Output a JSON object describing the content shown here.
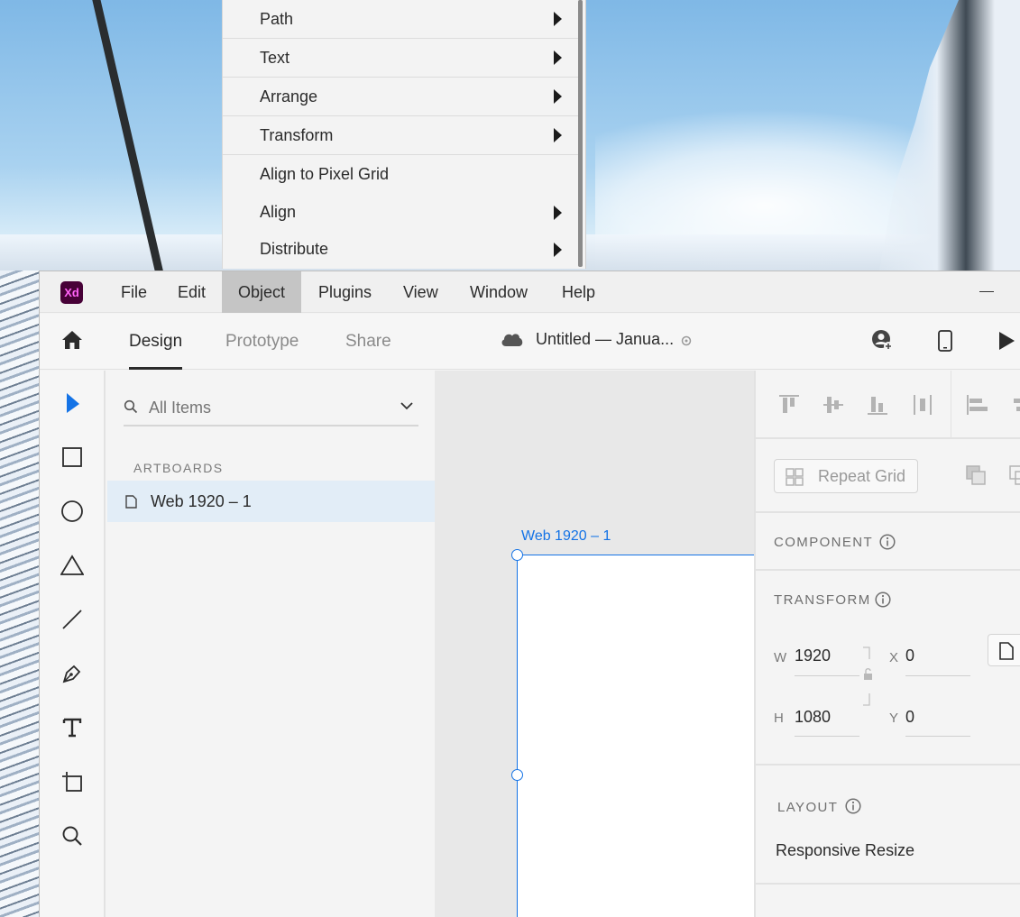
{
  "context_menu": {
    "items": [
      {
        "label": "Path",
        "submenu": true
      },
      {
        "label": "Text",
        "submenu": true
      },
      {
        "label": "Arrange",
        "submenu": true
      },
      {
        "label": "Transform",
        "submenu": true
      },
      {
        "label": "Align to Pixel Grid",
        "submenu": false
      },
      {
        "label": "Align",
        "submenu": true
      },
      {
        "label": "Distribute",
        "submenu": true
      }
    ]
  },
  "app": {
    "logo_text": "Xd",
    "menubar": [
      "File",
      "Edit",
      "Object",
      "Plugins",
      "View",
      "Window",
      "Help"
    ],
    "active_menu": "Object",
    "tabs": [
      "Design",
      "Prototype",
      "Share"
    ],
    "active_tab": "Design",
    "document_title": "Untitled — Janua...",
    "toolbar_icons": [
      "home-icon",
      "cloud-icon",
      "sync-icon",
      "invite-user-icon",
      "mobile-preview-icon",
      "play-icon"
    ],
    "tools": [
      "select-tool-icon",
      "rectangle-tool-icon",
      "ellipse-tool-icon",
      "polygon-tool-icon",
      "line-tool-icon",
      "pen-tool-icon",
      "text-tool-icon",
      "artboard-tool-icon",
      "zoom-tool-icon"
    ]
  },
  "layers": {
    "search_placeholder": "All Items",
    "section_label": "ARTBOARDS",
    "items": [
      {
        "label": "Web 1920 – 1"
      }
    ]
  },
  "canvas": {
    "artboard_label": "Web 1920 – 1"
  },
  "properties": {
    "repeat_grid_label": "Repeat Grid",
    "component_label": "COMPONENT",
    "transform_label": "TRANSFORM",
    "layout_label": "LAYOUT",
    "responsive_resize_label": "Responsive Resize",
    "w_label": "W",
    "w_value": "1920",
    "h_label": "H",
    "h_value": "1080",
    "x_label": "X",
    "x_value": "0",
    "y_label": "Y",
    "y_value": "0"
  },
  "colors": {
    "accent": "#1473e6",
    "xd_logo_bg": "#470137",
    "xd_logo_fg": "#ff61f6",
    "selected_layer_bg": "#e2edf7"
  }
}
